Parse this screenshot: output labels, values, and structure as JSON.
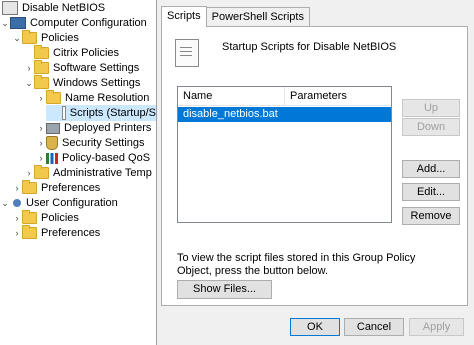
{
  "tree": {
    "root": "Disable NetBIOS",
    "computer_configuration": "Computer Configuration",
    "policies": "Policies",
    "citrix_policies": "Citrix Policies",
    "software_settings": "Software Settings",
    "windows_settings": "Windows Settings",
    "name_resolution": "Name Resolution",
    "scripts": "Scripts (Startup/S",
    "deployed_printers": "Deployed Printers",
    "security_settings": "Security Settings",
    "policy_based_qos": "Policy-based QoS",
    "administrative_templates": "Administrative Temp",
    "preferences": "Preferences",
    "user_configuration": "User Configuration",
    "user_policies": "Policies",
    "user_preferences": "Preferences"
  },
  "dialog": {
    "tabs": [
      "Scripts",
      "PowerShell Scripts"
    ],
    "heading": "Startup Scripts for Disable NetBIOS",
    "columns": [
      "Name",
      "Parameters"
    ],
    "rows": [
      {
        "name": "disable_netbios.bat",
        "parameters": ""
      }
    ],
    "buttons": {
      "up": "Up",
      "down": "Down",
      "add": "Add...",
      "edit": "Edit...",
      "remove": "Remove",
      "show_files": "Show Files...",
      "ok": "OK",
      "cancel": "Cancel",
      "apply": "Apply"
    },
    "info_text": "To view the script files stored in this Group Policy Object, press the button below."
  }
}
